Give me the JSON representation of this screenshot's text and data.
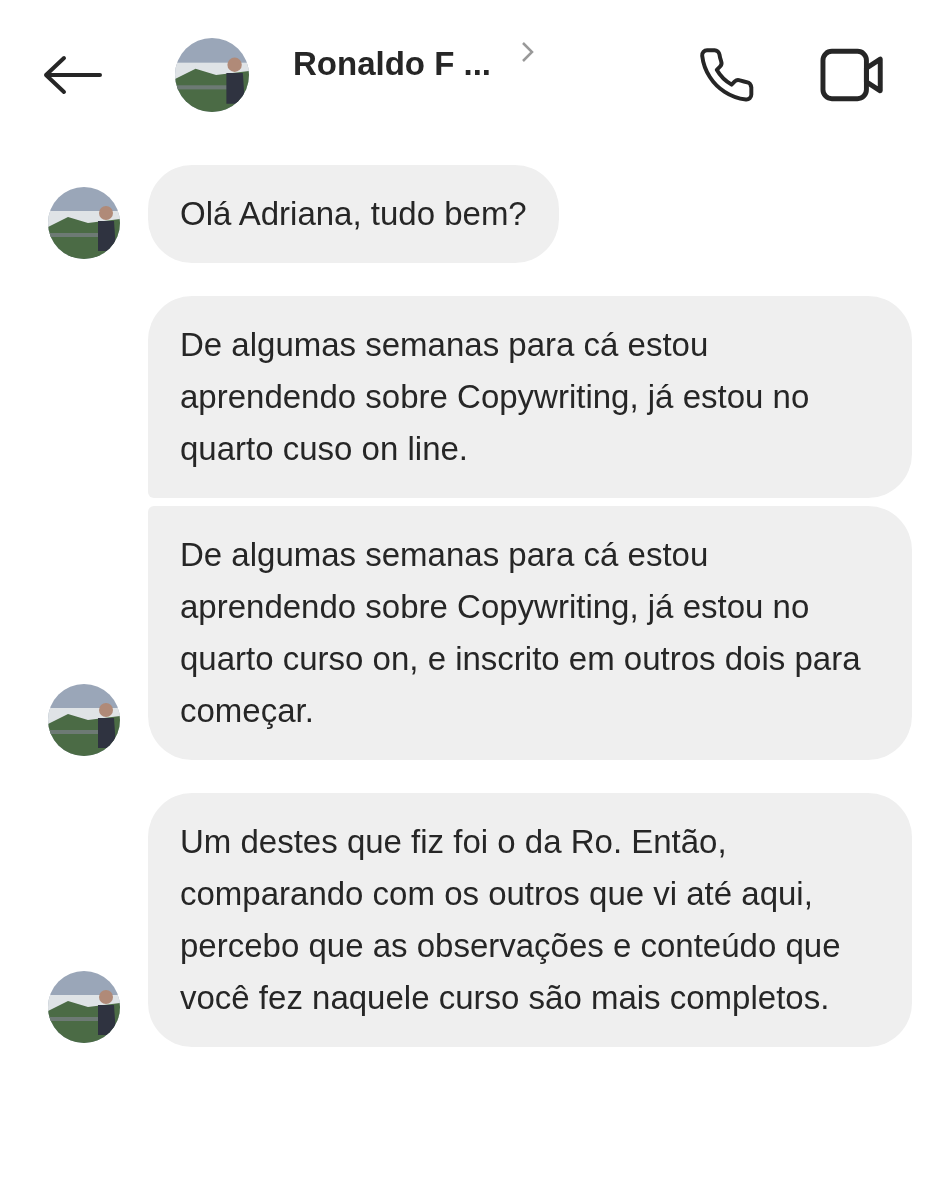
{
  "header": {
    "name": "Ronaldo F ..."
  },
  "messages": [
    {
      "text": "Olá Adriana, tudo bem?",
      "avatar": true,
      "continues": false
    },
    {
      "text": "De algumas semanas para cá estou aprendendo sobre Copywriting, já estou no quarto cuso on line.",
      "avatar": false,
      "continues": false
    },
    {
      "text": "De algumas semanas para cá estou aprendendo sobre Copywriting, já estou no quarto curso on, e inscrito em outros dois para começar.",
      "avatar": true,
      "continues": true
    },
    {
      "text": "Um destes que fiz foi o da Ro. Então, comparando com os outros que vi até aqui, percebo que as observações e conteúdo que você fez naquele curso são mais completos.",
      "avatar": true,
      "continues": false
    }
  ]
}
